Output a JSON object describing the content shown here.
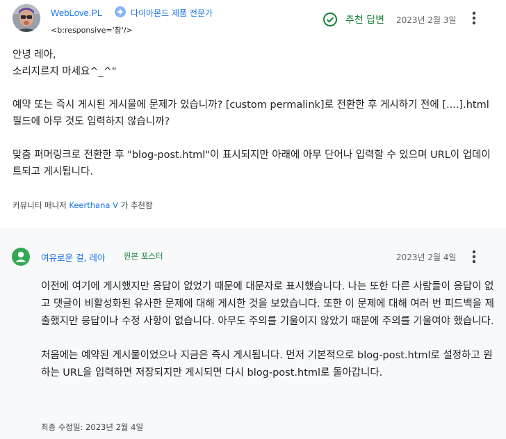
{
  "post1": {
    "author": "WebLove.PL",
    "badge": "다이아몬드 제품 전문가",
    "signature": "<b:responsive='참'/>",
    "recommended_label": "추천 답변",
    "date": "2023년 2월 3일",
    "body": {
      "greeting": "안녕 레아,",
      "line2": "소리지르지 마세요^_^\"",
      "para1": "예약 또는 즉시 게시된 게시물에 문제가 있습니까? [custom permalink]로 전환한 후 게시하기 전에 [....].html 필드에 아무 것도 입력하지 않습니까?",
      "para2": "맞춤 퍼머링크로 전환한 후 \"blog-post.html\"이 표시되지만 아래에 아무 단어나 입력할 수 있으며 URL이 업데이트되고 게시됩니다."
    },
    "recommended_by_prefix": "커뮤니티 매니저",
    "recommended_by_name": "Keerthana V",
    "recommended_by_suffix": "가 추천함"
  },
  "post2": {
    "author": "여유로운 걸, 레아",
    "op_badge": "원본 포스터",
    "date": "2023년 2월 4일",
    "body": {
      "para1": "이전에 여기에 게시했지만 응답이 없었기 때문에 대문자로 표시했습니다. 나는 또한 다른 사람들이 응답이 없고 댓글이 비활성화된 유사한 문제에 대해 게시한 것을 보았습니다. 또한 이 문제에 대해 여러 번 피드백을 제출했지만 응답이나 수정 사항이 없습니다. 아무도 주의를 기울이지 않았기 때문에 주의를 기울여야 했습니다.",
      "para2": "처음에는 예약된 게시물이었으나 지금은 즉시 게시됩니다. 먼저 기본적으로 blog-post.html로 설정하고 원하는 URL을 입력하면 저장되지만 게시되면 다시 blog-post.html로 돌아갑니다."
    },
    "edited": "최종 수정일: 2023년 2월 4일"
  },
  "icons": {
    "diamond_badge": "diamond-badge-icon",
    "recommended": "check-circle-icon",
    "more": "more-vert-icon",
    "default_avatar": "person-avatar-icon"
  },
  "colors": {
    "link": "#1a73e8",
    "green": "#188038",
    "secondary": "#5f6368",
    "alt_background": "#f8f9fa"
  }
}
